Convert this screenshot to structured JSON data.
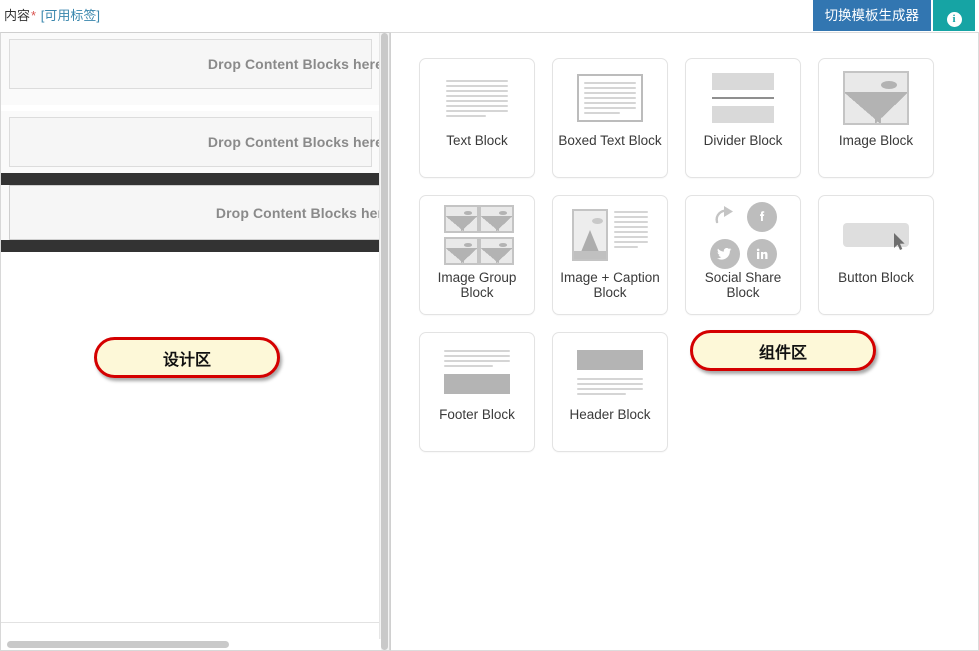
{
  "topbar": {
    "field_label": "内容",
    "required_mark": "*",
    "tag_link": "[可用标签]",
    "toggle_button": "切换模板生成器",
    "info_button_glyph": "i",
    "colors": {
      "toggle_button_bg": "#3276b1",
      "info_button_bg": "#16a4a4",
      "required_mark": "#d9534f",
      "tag_link": "#3a87ad"
    }
  },
  "design_panel": {
    "dropzones": [
      {
        "text": "Drop Content Blocks here",
        "selected": false
      },
      {
        "text": "Drop Content Blocks here",
        "selected": false
      },
      {
        "text": "Drop Content Blocks here",
        "selected": true
      }
    ],
    "selected_bar_color": "#333333",
    "scrollbars": {
      "vertical": true,
      "horizontal": true
    }
  },
  "palette_panel": {
    "blocks": [
      {
        "label": "Text Block",
        "icon": "text-lines-icon"
      },
      {
        "label": "Boxed Text Block",
        "icon": "boxed-text-icon"
      },
      {
        "label": "Divider Block",
        "icon": "divider-icon"
      },
      {
        "label": "Image Block",
        "icon": "image-icon"
      },
      {
        "label": "Image Group Block",
        "icon": "image-group-icon"
      },
      {
        "label": "Image + Caption Block",
        "icon": "image-caption-icon"
      },
      {
        "label": "Social Share Block",
        "icon": "social-share-icon"
      },
      {
        "label": "Button Block",
        "icon": "button-cursor-icon"
      },
      {
        "label": "Footer Block",
        "icon": "footer-icon"
      },
      {
        "label": "Header Block",
        "icon": "header-icon"
      }
    ]
  },
  "annotations": [
    {
      "text": "设计区",
      "target": "design-panel"
    },
    {
      "text": "组件区",
      "target": "palette-panel"
    }
  ]
}
